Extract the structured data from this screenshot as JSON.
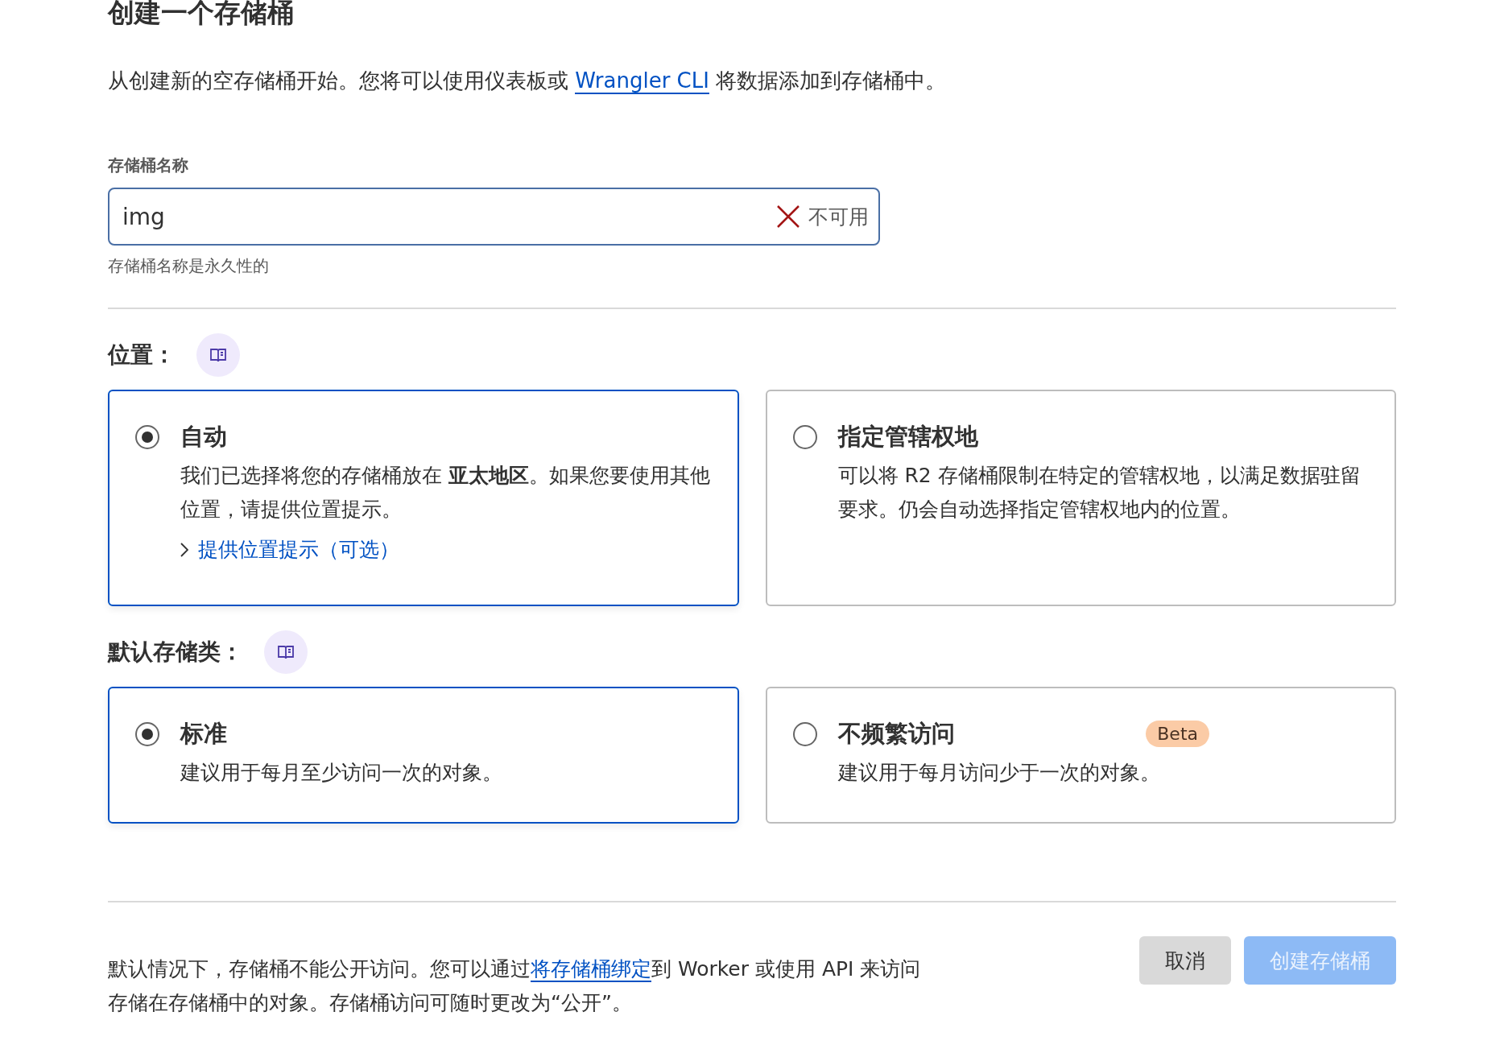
{
  "title": "创建一个存储桶",
  "intro": {
    "before": "从创建新的空存储桶开始。您将可以使用仪表板或 ",
    "link": "Wrangler CLI",
    "after": " 将数据添加到存储桶中。"
  },
  "name_field": {
    "label": "存储桶名称",
    "value": "img",
    "status": {
      "kind": "error",
      "text": "不可用"
    },
    "help": "存储桶名称是永久性的"
  },
  "sections": [
    {
      "label": "位置：",
      "options": [
        {
          "title": "自动",
          "selected": true,
          "description": "我们已选择将您的存储桶放在 **亚太地区**。如果您要使用其他位置，请提供位置提示。",
          "link": "提供位置提示（可选）"
        },
        {
          "title": "指定管辖权地",
          "selected": false,
          "description": "可以将 R2 存储桶限制在特定的管辖权地，以满足数据驻留要求。仍会自动选择指定管辖权地内的位置。"
        }
      ]
    },
    {
      "label": "默认存储类：",
      "options": [
        {
          "title": "标准",
          "selected": true,
          "description": "建议用于每月至少访问一次的对象。"
        },
        {
          "title": "不频繁访问",
          "selected": false,
          "badge": "Beta",
          "description": "建议用于每月访问少于一次的对象。"
        }
      ]
    }
  ],
  "footer": {
    "before": "默认情况下，存储桶不能公开访问。您可以通过",
    "link": "将存储桶绑定",
    "after": "到 Worker 或使用 API 来访问存储在存储桶中的对象。存储桶访问可随时更改为“公开”。"
  },
  "buttons": [
    {
      "label": "取消",
      "kind": "secondary",
      "disabled": false
    },
    {
      "label": "创建存储桶",
      "kind": "primary",
      "disabled": true
    }
  ]
}
